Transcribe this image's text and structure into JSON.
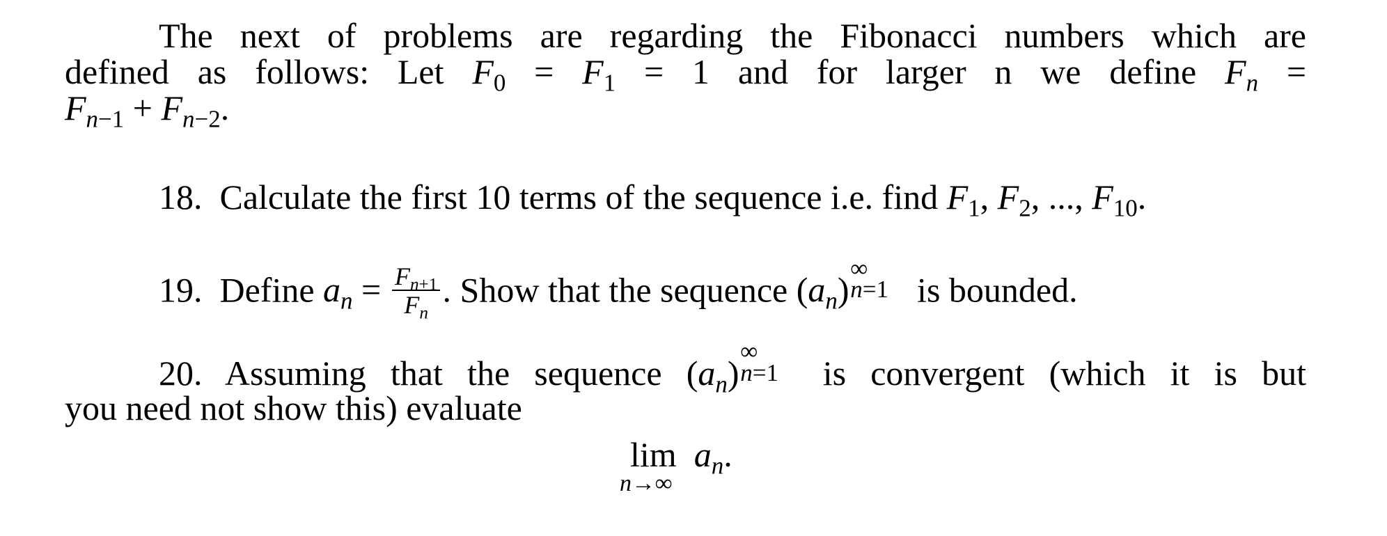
{
  "document": {
    "intro": {
      "line1": "The next of problems are regarding the Fibonacci numbers which are",
      "line2_words": [
        "defined",
        "as",
        "follows:",
        "Let"
      ],
      "line2_tail": [
        "and",
        "for",
        "larger",
        "n",
        "we",
        "define"
      ],
      "line3_tail": "."
    },
    "problems": [
      {
        "number": "18.",
        "text": "Calculate the first 10 terms of the sequence i.e. find",
        "math_tail": "F1, F2, ..., F10."
      },
      {
        "number": "19.",
        "text_before": "Define",
        "text_after": ". Show that the sequence",
        "text_end": "is bounded."
      },
      {
        "number": "20.",
        "text_before": "Assuming that the sequence",
        "text_after": "is convergent (which it is but",
        "line2": "you need not show this) evaluate",
        "display": {
          "operator": "lim",
          "under": "n→∞",
          "expr_base": "a",
          "expr_sub": "n",
          "end": "."
        }
      }
    ]
  }
}
